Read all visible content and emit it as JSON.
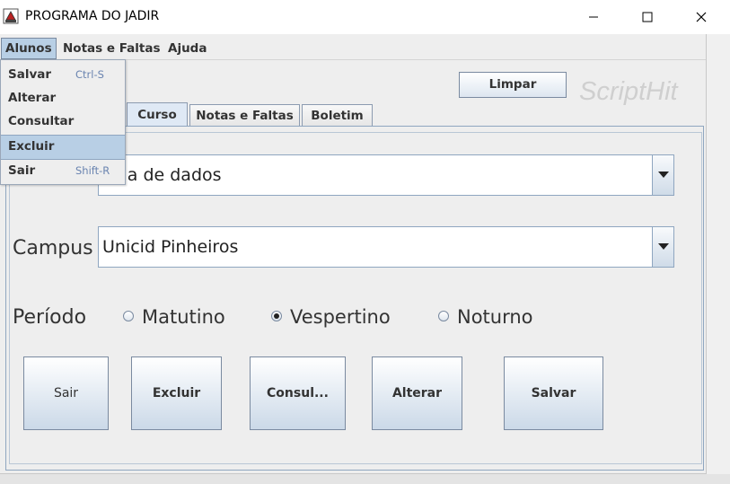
{
  "window": {
    "title": "PROGRAMA DO JADIR"
  },
  "menubar": [
    {
      "label": "Alunos",
      "active": true
    },
    {
      "label": "Notas e Faltas"
    },
    {
      "label": "Ajuda"
    }
  ],
  "alunos_menu": [
    {
      "label": "Salvar",
      "accel": "Ctrl-S"
    },
    {
      "label": "Alterar"
    },
    {
      "label": "Consultar"
    },
    {
      "label": "Excluir",
      "highlighted": true
    },
    {
      "label": "Sair",
      "accel": "Shift-R"
    }
  ],
  "toolbar": {
    "limpar_label": "Limpar",
    "watermark": "ScriptHit"
  },
  "tabs": [
    {
      "label": "Curso",
      "selected": true
    },
    {
      "label": "Notas e Faltas"
    },
    {
      "label": "Boletim"
    }
  ],
  "form": {
    "curso_value": "ncia de dados",
    "campus_label": "Campus",
    "campus_value": "Unicid Pinheiros",
    "periodo_label": "Período",
    "periodo_options": [
      {
        "label": "Matutino",
        "selected": false
      },
      {
        "label": "Vespertino",
        "selected": true
      },
      {
        "label": "Noturno",
        "selected": false
      }
    ]
  },
  "buttons": {
    "sair": "Sair",
    "excluir": "Excluir",
    "consultar": "Consul...",
    "alterar": "Alterar",
    "salvar": "Salvar"
  },
  "colors": {
    "menu_highlight": "#b8cfe5",
    "accel_text": "#6a84b0",
    "watermark": "#cfcfcf"
  }
}
